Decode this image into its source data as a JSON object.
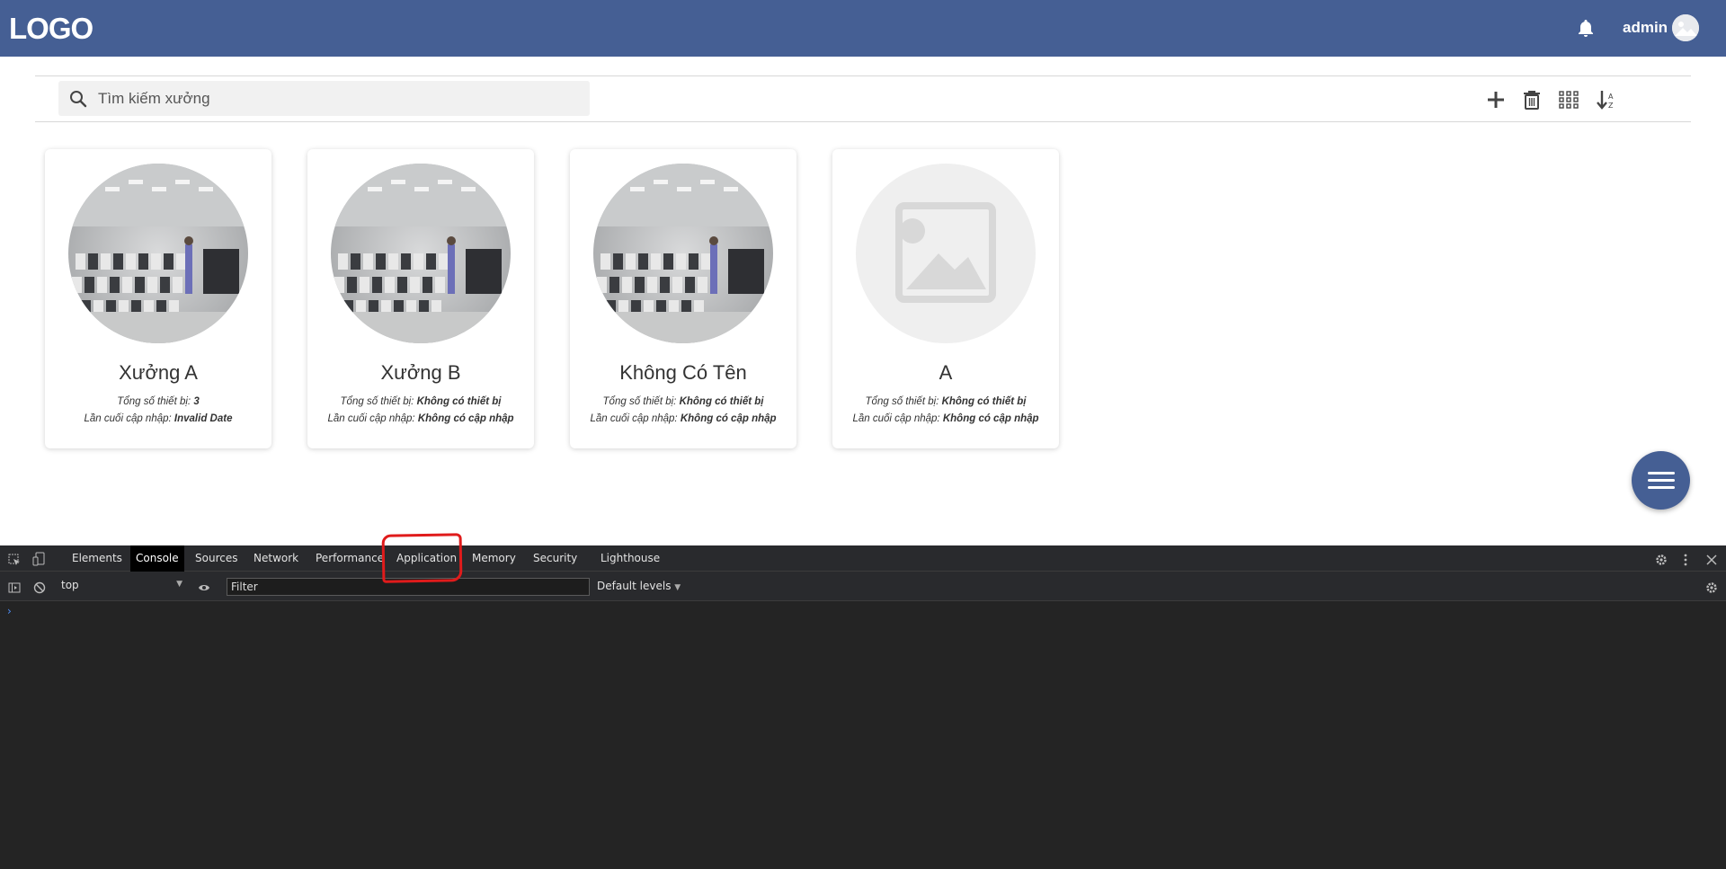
{
  "header": {
    "logo": "LOGO",
    "username": "admin",
    "icons": {
      "notification": "bell-icon",
      "avatar": "avatar"
    },
    "color": "#455f94"
  },
  "toolbar": {
    "search_placeholder": "Tìm kiếm xưởng",
    "actions": [
      "add-icon",
      "trash-icon",
      "grid-view-icon",
      "sort-az-icon"
    ]
  },
  "workshops": [
    {
      "name": "Xưởng A",
      "devices_label": "Tổng số thiết bị:",
      "devices_value": "3",
      "updated_label": "Lần cuối cập nhập:",
      "updated_value": "Invalid Date",
      "image": "factory-photo"
    },
    {
      "name": "Xưởng B",
      "devices_label": "Tổng số thiết bị:",
      "devices_value": "Không có thiết bị",
      "updated_label": "Lần cuối cập nhập:",
      "updated_value": "Không có cập nhập",
      "image": "factory-photo"
    },
    {
      "name": "Không Có Tên",
      "devices_label": "Tổng số thiết bị:",
      "devices_value": "Không có thiết bị",
      "updated_label": "Lần cuối cập nhập:",
      "updated_value": "Không có cập nhập",
      "image": "factory-photo"
    },
    {
      "name": "A",
      "devices_label": "Tổng số thiết bị:",
      "devices_value": "Không có thiết bị",
      "updated_label": "Lần cuối cập nhập:",
      "updated_value": "Không có cập nhập",
      "image": "image-placeholder-icon"
    }
  ],
  "fab": {
    "icon": "menu-icon"
  },
  "devtools": {
    "tabs": [
      {
        "label": "Elements",
        "active": false
      },
      {
        "label": "Console",
        "active": true
      },
      {
        "label": "Sources",
        "active": false
      },
      {
        "label": "Network",
        "active": false
      },
      {
        "label": "Performance",
        "active": false
      },
      {
        "label": "Application",
        "active": false,
        "highlighted": true
      },
      {
        "label": "Memory",
        "active": false
      },
      {
        "label": "Security",
        "active": false
      },
      {
        "label": "Lighthouse",
        "active": false
      }
    ],
    "context": "top",
    "filter_placeholder": "Filter",
    "levels": "Default levels",
    "prompt": "›",
    "annotation_color": "#e01b1b"
  }
}
